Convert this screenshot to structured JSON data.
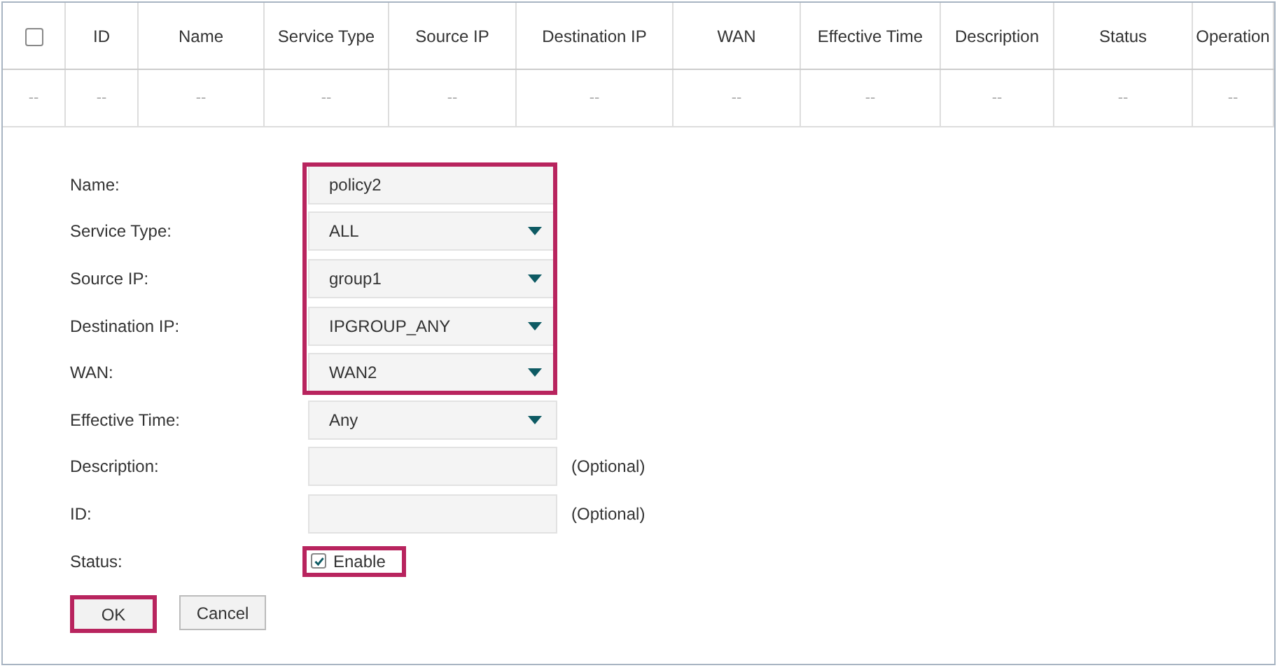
{
  "table": {
    "select_all": {
      "checked": false
    },
    "columns": [
      "",
      "ID",
      "Name",
      "Service Type",
      "Source IP",
      "Destination IP",
      "WAN",
      "Effective Time",
      "Description",
      "Status",
      "Operation"
    ],
    "rows": [
      [
        "--",
        "--",
        "--",
        "--",
        "--",
        "--",
        "--",
        "--",
        "--",
        "--",
        "--"
      ]
    ]
  },
  "form": {
    "fields": [
      {
        "kind": "text",
        "label": "Name:",
        "value": "policy2",
        "highlighted": true
      },
      {
        "kind": "select",
        "label": "Service Type:",
        "value": "ALL",
        "highlighted": true
      },
      {
        "kind": "select",
        "label": "Source IP:",
        "value": "group1",
        "highlighted": true
      },
      {
        "kind": "select",
        "label": "Destination IP:",
        "value": "IPGROUP_ANY",
        "highlighted": true
      },
      {
        "kind": "select",
        "label": "WAN:",
        "value": "WAN2",
        "highlighted": true
      },
      {
        "kind": "select",
        "label": "Effective Time:",
        "value": "Any",
        "highlighted": false
      },
      {
        "kind": "text",
        "label": "Description:",
        "note": "(Optional)",
        "highlighted": false
      },
      {
        "kind": "text",
        "label": "ID:",
        "note": "(Optional)",
        "highlighted": false
      },
      {
        "kind": "checkbox",
        "label": "Status:",
        "option": "Enable",
        "checked": true,
        "highlighted": true
      }
    ],
    "buttons": [
      {
        "label": "OK",
        "highlighted": true
      },
      {
        "label": "Cancel",
        "highlighted": false
      }
    ]
  }
}
